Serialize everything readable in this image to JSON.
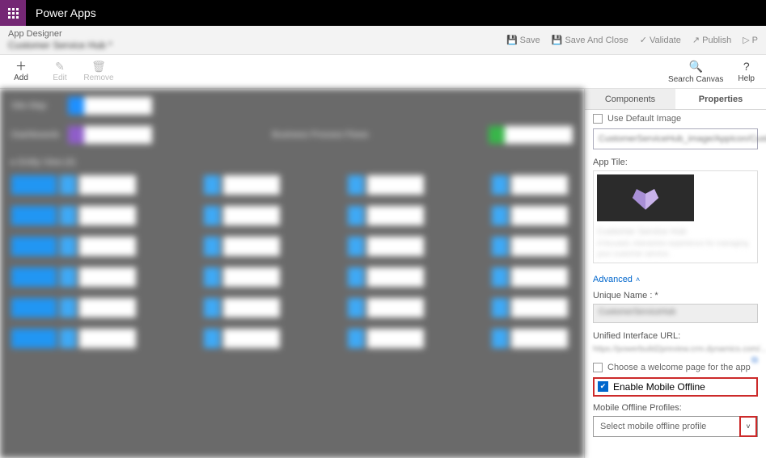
{
  "titlebar": {
    "product": "Power Apps"
  },
  "breadcrumb": {
    "label": "App Designer",
    "sub": "Customer Service Hub *",
    "actions": {
      "save": "Save",
      "save_close": "Save And Close",
      "validate": "Validate",
      "publish": "Publish",
      "play": "P"
    }
  },
  "toolbar": {
    "add": "Add",
    "edit": "Edit",
    "remove": "Remove",
    "search": "Search Canvas",
    "help": "Help"
  },
  "panel": {
    "tabs": {
      "components": "Components",
      "properties": "Properties"
    },
    "use_default_image": "Use Default Image",
    "image_select": "CustomerServiceHub_image/AppIcon/CustomerS",
    "app_tile_label": "App Tile:",
    "tile_title": "Customer Service Hub",
    "tile_sub": "A focused, interactive experience for managing your customer service.",
    "advanced": "Advanced",
    "unique_name_label": "Unique Name : *",
    "unique_name_value": "CustomerServiceHub",
    "unified_url_label": "Unified Interface URL:",
    "unified_url_value": "https://powerbuild2preview.crm.dynamics.com/...",
    "welcome_label": "Choose a welcome page for the app",
    "enable_offline_label": "Enable Mobile Offline",
    "profiles_label": "Mobile Offline Profiles:",
    "profiles_placeholder": "Select mobile offline profile"
  }
}
